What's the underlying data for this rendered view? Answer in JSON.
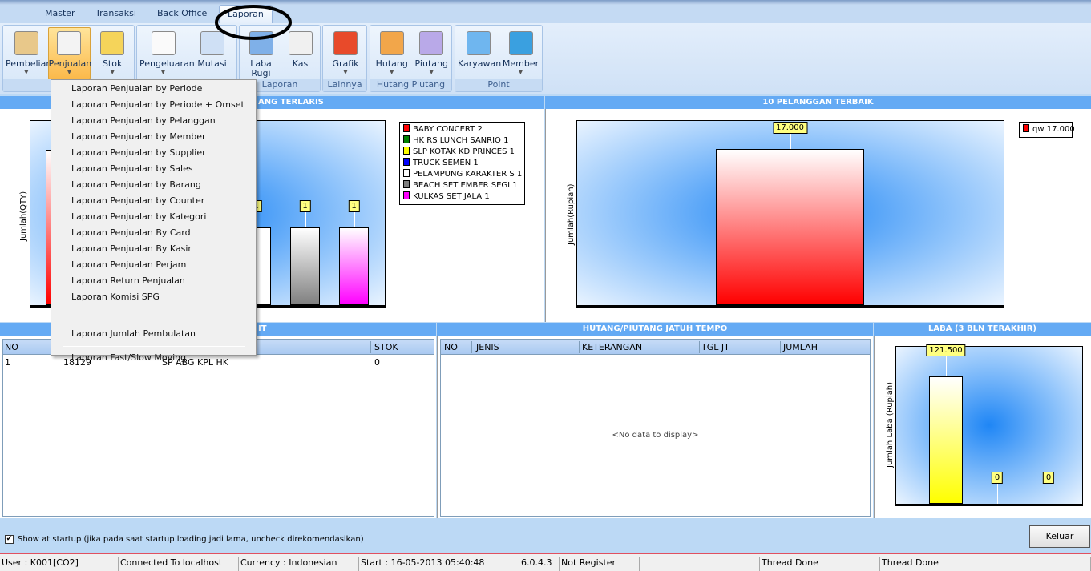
{
  "tabs": [
    "Master",
    "Transaksi",
    "Back Office",
    "Laporan"
  ],
  "ribbon": {
    "groups": [
      {
        "label": "",
        "buttons": [
          {
            "label": "Pembelian",
            "icon": "document-icon",
            "caret": true
          },
          {
            "label": "Penjualan",
            "icon": "documents-icon",
            "caret": true,
            "selected": true
          },
          {
            "label": "Stok",
            "icon": "boxes-icon",
            "caret": true
          }
        ]
      },
      {
        "label": "",
        "buttons": [
          {
            "label": "Pengeluaran",
            "icon": "hash-document-icon",
            "caret": true
          },
          {
            "label": "Mutasi",
            "icon": "transfer-icon",
            "caret": false
          }
        ]
      },
      {
        "label": "Laporan",
        "buttons": [
          {
            "label": "Laba",
            "label2": "Rugi",
            "icon": "spreadsheet-icon",
            "caret": false
          },
          {
            "label": "Kas",
            "icon": "ledger-icon",
            "caret": false
          }
        ]
      },
      {
        "label": "Lainnya",
        "buttons": [
          {
            "label": "Grafik",
            "icon": "bar-chart-icon",
            "caret": true
          }
        ]
      },
      {
        "label": "Hutang Piutang",
        "buttons": [
          {
            "label": "Hutang",
            "icon": "person-speech-icon",
            "caret": true
          },
          {
            "label": "Piutang",
            "icon": "id-card-icon",
            "caret": true
          }
        ]
      },
      {
        "label": "Point",
        "buttons": [
          {
            "label": "Karyawan",
            "icon": "employee-icon",
            "caret": false
          },
          {
            "label": "Member",
            "icon": "members-icon",
            "caret": true
          }
        ]
      }
    ]
  },
  "menu": {
    "items": [
      "Laporan Penjualan by Periode",
      "Laporan Penjualan by Periode + Omset",
      "Laporan Penjualan by Pelanggan",
      "Laporan Penjualan by Member",
      "Laporan Penjualan by Supplier",
      "Laporan Penjualan by Sales",
      "Laporan Penjualan by Barang",
      "Laporan Penjualan by Counter",
      "Laporan Penjualan by Kategori",
      "Laporan Penjualan By Card",
      "Laporan Penjualan By Kasir",
      "Laporan Penjualan Perjam",
      "Laporan Return Penjualan",
      "Laporan Komisi SPG"
    ],
    "items2": [
      "Laporan Jumlah Pembulatan"
    ],
    "items3": [
      "Laporan Fast/Slow Moving"
    ]
  },
  "panels": {
    "top_left_title": "ANG TERLARIS",
    "top_right_title": "10 PELANGGAN TERBAIK",
    "bottom_left_title": "IT",
    "bottom_mid_title": "HUTANG/PIUTANG JATUH TEMPO",
    "bottom_right_title": "LABA (3 BLN TERAKHIR)"
  },
  "chart_data": [
    {
      "type": "bar",
      "title": "",
      "ylabel": "Jumlah(QTY)",
      "categories": [
        "BABY CONCERT",
        "HK RS LUNCH SANRIO",
        "SLP KOTAK KD PRINCES",
        "TRUCK SEMEN",
        "PELAMPUNG KARAKTER S",
        "BEACH SET EMBER SEGI",
        "KULKAS SET JALA"
      ],
      "values": [
        2,
        1,
        1,
        1,
        1,
        1,
        1
      ],
      "data_labels": [
        "2",
        "1",
        "1",
        "1",
        "1",
        "1",
        "1"
      ],
      "colors": [
        "#ff0000",
        "#008000",
        "#ffff00",
        "#0000ff",
        "#ffffff",
        "#808080",
        "#ff00ff"
      ],
      "legend": [
        "BABY CONCERT 2",
        "HK RS LUNCH SANRIO 1",
        "SLP KOTAK KD PRINCES 1",
        "TRUCK SEMEN 1",
        "PELAMPUNG KARAKTER S 1",
        "BEACH SET EMBER SEGI 1",
        "KULKAS SET JALA 1"
      ],
      "legend_position": "right"
    },
    {
      "type": "bar",
      "title": "",
      "ylabel": "Jumlah(Rupiah)",
      "categories": [
        "qw"
      ],
      "values": [
        17000
      ],
      "data_labels": [
        "17.000"
      ],
      "colors": [
        "#ff0000"
      ],
      "legend": [
        "qw 17.000"
      ],
      "legend_position": "top-right"
    },
    {
      "type": "bar",
      "title": "",
      "ylabel": "Jumlah Laba (Rupiah)",
      "categories": [
        "",
        "",
        ""
      ],
      "values": [
        0,
        0,
        121500
      ],
      "data_labels": [
        "0",
        "0",
        "121.500"
      ],
      "colors": [
        "#ffff00",
        "#ffff00",
        "#ffff00"
      ]
    }
  ],
  "stock_table": {
    "headers": [
      "NO",
      "",
      "",
      "STOK"
    ],
    "rows": [
      [
        "1",
        "18129",
        "SP ABG KPL HK",
        "0"
      ]
    ]
  },
  "due_table": {
    "headers": [
      "NO",
      "JENIS",
      "KETERANGAN",
      "TGL JT",
      "JUMLAH"
    ],
    "empty": "<No data to display>"
  },
  "footer": {
    "show_startup": "Show at startup (jika pada saat startup loading jadi lama, uncheck direkomendasikan)",
    "checked": true,
    "exit": "Keluar"
  },
  "status": [
    "User : K001[CO2]",
    "Connected To localhost",
    "Currency : Indonesian",
    "Start  : 16-05-2013 05:40:48",
    "6.0.4.3",
    "Not Register",
    "",
    "Thread Done",
    "Thread Done"
  ]
}
